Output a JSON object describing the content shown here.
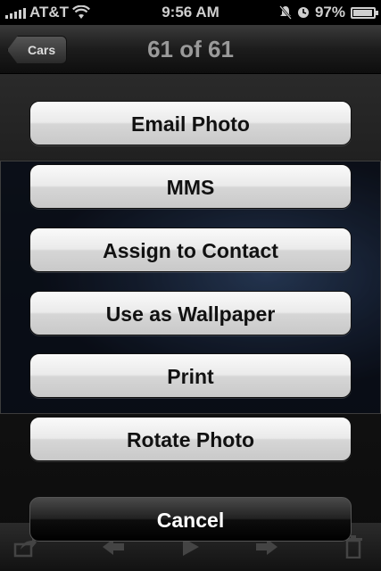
{
  "status_bar": {
    "carrier": "AT&T",
    "time": "9:56 AM",
    "battery_percent": "97%",
    "battery_level": 0.97
  },
  "nav": {
    "back_label": "Cars",
    "title": "61 of 61"
  },
  "action_sheet": {
    "buttons": [
      {
        "label": "Email Photo"
      },
      {
        "label": "MMS"
      },
      {
        "label": "Assign to Contact"
      },
      {
        "label": "Use as Wallpaper"
      },
      {
        "label": "Print"
      },
      {
        "label": "Rotate Photo"
      }
    ],
    "cancel_label": "Cancel"
  },
  "toolbar": {
    "icons": [
      "share-icon",
      "previous-icon",
      "play-icon",
      "next-icon",
      "trash-icon"
    ]
  }
}
